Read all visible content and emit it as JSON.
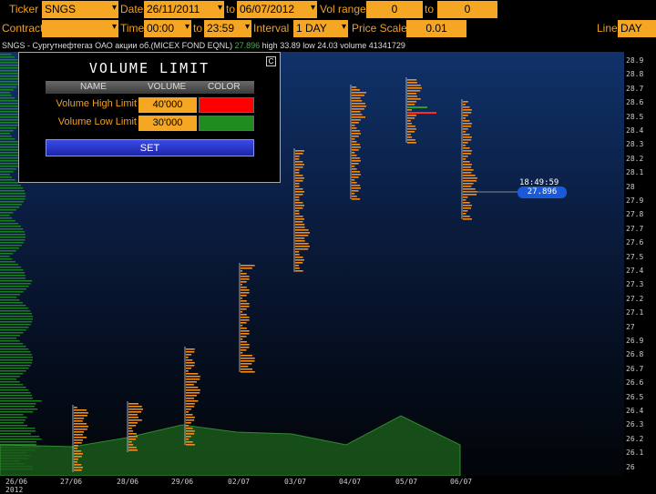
{
  "toolbar": {
    "ticker_label": "Ticker",
    "ticker_value": "SNGS",
    "date_label": "Date",
    "date_from": "26/11/2011",
    "date_to_label": "to",
    "date_to": "06/07/2012",
    "vol_range_label": "Vol range",
    "vol_from": "0",
    "vol_to_label": "to",
    "vol_to": "0",
    "contract_label": "Contract",
    "contract_value": "",
    "time_label": "Time",
    "time_from": "00:00",
    "time_to_label": "to",
    "time_to": "23:59",
    "interval_label": "Interval",
    "interval_value": "1 DAY",
    "price_scale_label": "Price Scale",
    "price_scale_value": "0.01",
    "line_label": "Line",
    "line_value": "DAY"
  },
  "title_bar": {
    "ticker": "SNGS",
    "name": "Сургутнефтегаз ОАО акции об.(MICEX FOND EQNL)",
    "last": "27.896",
    "high": "high 33.89",
    "low": "low 24.03",
    "volume": "volume 41341729"
  },
  "dialog": {
    "title": "VOLUME LIMIT",
    "close": "C",
    "col_name": "NAME",
    "col_volume": "VOLUME",
    "col_color": "COLOR",
    "rows": [
      {
        "name": "Volume High Limit",
        "volume": "40'000",
        "color": "#ff0000"
      },
      {
        "name": "Volume Low Limit",
        "volume": "30'000",
        "color": "#1e8c1e"
      }
    ],
    "set_label": "SET"
  },
  "price_tag": {
    "time": "18:49:59",
    "price": "27.896"
  },
  "y_ticks": [
    "28.9",
    "28.8",
    "28.7",
    "28.6",
    "28.5",
    "28.4",
    "28.3",
    "28.2",
    "28.1",
    "28",
    "27.9",
    "27.8",
    "27.7",
    "27.6",
    "27.5",
    "27.4",
    "27.3",
    "27.2",
    "27.1",
    "27",
    "26.9",
    "26.8",
    "26.7",
    "26.6",
    "26.5",
    "26.4",
    "26.3",
    "26.2",
    "26.1",
    "26"
  ],
  "x_ticks": [
    "26/06",
    "27/06",
    "28/06",
    "29/06",
    "02/07",
    "03/07",
    "04/07",
    "05/07",
    "06/07"
  ],
  "x_year": "2012",
  "colors": {
    "accent": "#f5a623",
    "volume_bar": "#f08c1e",
    "profile_green": "#1e8c1e"
  }
}
